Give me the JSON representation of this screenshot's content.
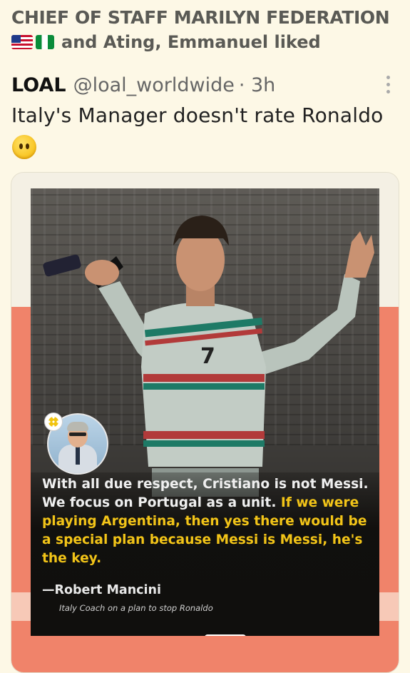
{
  "context": {
    "title": "CHIEF OF STAFF MARILYN FEDERATION",
    "liked_text": "and Ating, Emmanuel liked",
    "flags": [
      "us-flag-icon",
      "nigeria-flag-icon"
    ]
  },
  "post": {
    "author_name": "LOAL",
    "handle": "@loal_worldwide",
    "time": "· 3h",
    "text": "Italy's Manager doesn't rate Ronaldo",
    "emoji": "confused-face-emoji"
  },
  "media": {
    "quote_white": "With all due respect, Cristiano is not Messi. We focus on Portugal as a unit.",
    "quote_yellow": "If we were playing Argentina, then yes there would be a special plan because Messi is Messi, he's the key.",
    "attribution": "—Robert Mancini",
    "subtitle": "Italy Coach on a plan to stop Ronaldo",
    "colors": {
      "background_band": "#f0836a",
      "quote_highlight": "#f2c418"
    }
  }
}
